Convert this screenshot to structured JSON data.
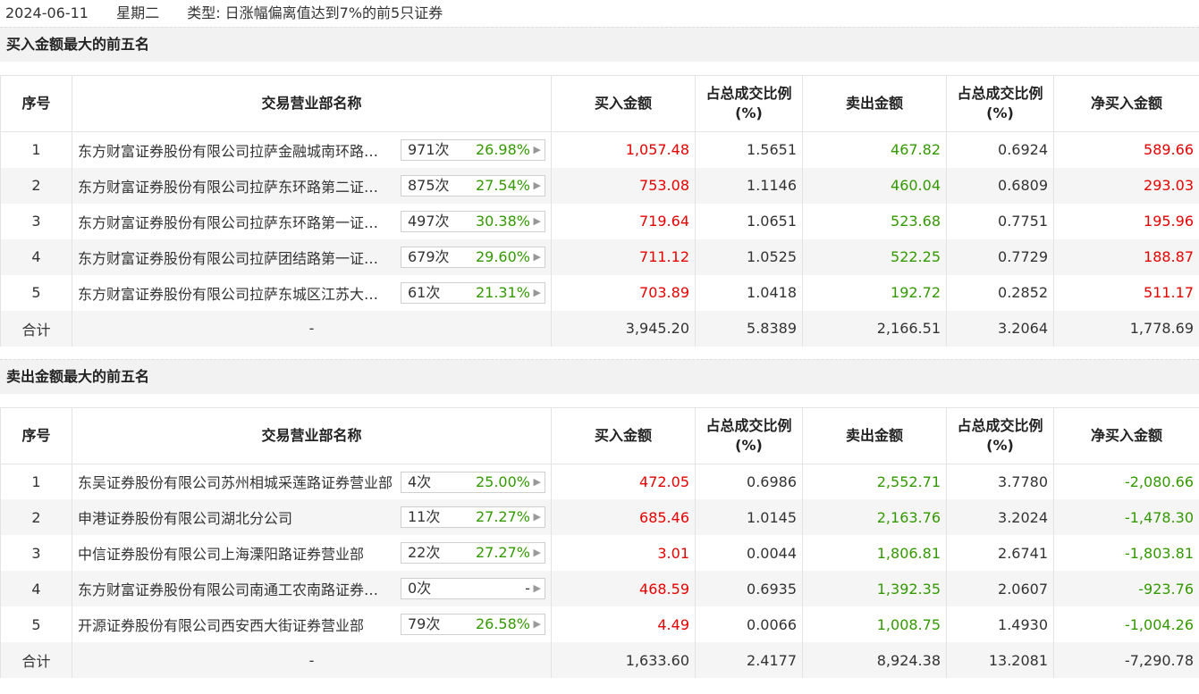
{
  "header": {
    "date": "2024-06-11",
    "weekday": "星期二",
    "type_label": "类型: 日涨幅偏离值达到7%的前5只证券"
  },
  "columns": {
    "seq": "序号",
    "dept": "交易营业部名称",
    "buy": "买入金额",
    "buy_ratio": "占总成交比例(%)",
    "sell": "卖出金额",
    "sell_ratio": "占总成交比例(%)",
    "net": "净买入金额"
  },
  "buy_section": {
    "title": "买入金额最大的前五名",
    "rows": [
      {
        "seq": "1",
        "dept": "东方财富证券股份有限公司拉萨金融城南环路证券营业部",
        "count": "971次",
        "rate": "26.98%",
        "buy": "1,057.48",
        "buy_ratio": "1.5651",
        "sell": "467.82",
        "sell_ratio": "0.6924",
        "net": "589.66"
      },
      {
        "seq": "2",
        "dept": "东方财富证券股份有限公司拉萨东环路第二证券营业部",
        "count": "875次",
        "rate": "27.54%",
        "buy": "753.08",
        "buy_ratio": "1.1146",
        "sell": "460.04",
        "sell_ratio": "0.6809",
        "net": "293.03"
      },
      {
        "seq": "3",
        "dept": "东方财富证券股份有限公司拉萨东环路第一证券营业部",
        "count": "497次",
        "rate": "30.38%",
        "buy": "719.64",
        "buy_ratio": "1.0651",
        "sell": "523.68",
        "sell_ratio": "0.7751",
        "net": "195.96"
      },
      {
        "seq": "4",
        "dept": "东方财富证券股份有限公司拉萨团结路第一证券营业部",
        "count": "679次",
        "rate": "29.60%",
        "buy": "711.12",
        "buy_ratio": "1.0525",
        "sell": "522.25",
        "sell_ratio": "0.7729",
        "net": "188.87"
      },
      {
        "seq": "5",
        "dept": "东方财富证券股份有限公司拉萨东城区江苏大道证券营业部",
        "count": "61次",
        "rate": "21.31%",
        "buy": "703.89",
        "buy_ratio": "1.0418",
        "sell": "192.72",
        "sell_ratio": "0.2852",
        "net": "511.17"
      }
    ],
    "total": {
      "label": "合计",
      "dept": "-",
      "buy": "3,945.20",
      "buy_ratio": "5.8389",
      "sell": "2,166.51",
      "sell_ratio": "3.2064",
      "net": "1,778.69"
    }
  },
  "sell_section": {
    "title": "卖出金额最大的前五名",
    "rows": [
      {
        "seq": "1",
        "dept": "东吴证券股份有限公司苏州相城采莲路证券营业部",
        "count": "4次",
        "rate": "25.00%",
        "buy": "472.05",
        "buy_ratio": "0.6986",
        "sell": "2,552.71",
        "sell_ratio": "3.7780",
        "net": "-2,080.66"
      },
      {
        "seq": "2",
        "dept": "申港证券股份有限公司湖北分公司",
        "count": "11次",
        "rate": "27.27%",
        "buy": "685.46",
        "buy_ratio": "1.0145",
        "sell": "2,163.76",
        "sell_ratio": "3.2024",
        "net": "-1,478.30"
      },
      {
        "seq": "3",
        "dept": "中信证券股份有限公司上海溧阳路证券营业部",
        "count": "22次",
        "rate": "27.27%",
        "buy": "3.01",
        "buy_ratio": "0.0044",
        "sell": "1,806.81",
        "sell_ratio": "2.6741",
        "net": "-1,803.81"
      },
      {
        "seq": "4",
        "dept": "东方财富证券股份有限公司南通工农南路证券营业部",
        "count": "0次",
        "rate": "-",
        "buy": "468.59",
        "buy_ratio": "0.6935",
        "sell": "1,392.35",
        "sell_ratio": "2.0607",
        "net": "-923.76"
      },
      {
        "seq": "5",
        "dept": "开源证券股份有限公司西安西大街证券营业部",
        "count": "79次",
        "rate": "26.58%",
        "buy": "4.49",
        "buy_ratio": "0.0066",
        "sell": "1,008.75",
        "sell_ratio": "1.4930",
        "net": "-1,004.26"
      }
    ],
    "total": {
      "label": "合计",
      "dept": "-",
      "buy": "1,633.60",
      "buy_ratio": "2.4177",
      "sell": "8,924.38",
      "sell_ratio": "13.2081",
      "net": "-7,290.78"
    }
  },
  "colors": {
    "buy": "#e60000",
    "sell": "#339900",
    "net_positive": "#e60000",
    "net_negative": "#339900"
  },
  "icons": {
    "badge_arrow": "chevron-right-icon"
  }
}
